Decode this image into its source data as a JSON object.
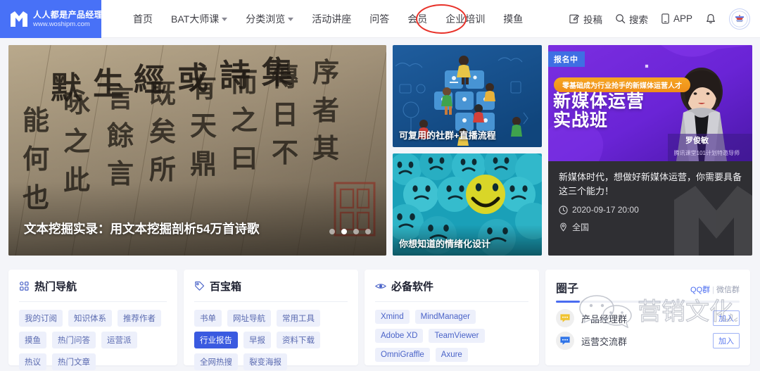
{
  "header": {
    "logo": {
      "icon": "woshipm-logo-icon",
      "cn": "人人都是产品经理",
      "url": "www.woshipm.com"
    },
    "nav": [
      {
        "label": "首页",
        "caret": false
      },
      {
        "label": "BAT大师课",
        "caret": true
      },
      {
        "label": "分类浏览",
        "caret": true
      },
      {
        "label": "活动讲座",
        "caret": false
      },
      {
        "label": "问答",
        "caret": false
      },
      {
        "label": "会员",
        "caret": false
      },
      {
        "label": "企业培训",
        "caret": false
      },
      {
        "label": "摸鱼",
        "caret": false
      }
    ],
    "actions": [
      {
        "icon": "compose-icon",
        "label": "投稿"
      },
      {
        "icon": "search-icon",
        "label": "搜索"
      },
      {
        "icon": "phone-icon",
        "label": "APP"
      },
      {
        "icon": "bell-icon",
        "label": ""
      }
    ],
    "avatar_label": "user-avatar",
    "annotation_color": "#e8322a",
    "annotation_target": "摸鱼"
  },
  "hero": {
    "title": "文本挖掘实录：用文本挖掘剖析54万首诗歌",
    "dots": 4,
    "active_dot": 2
  },
  "midcards": [
    {
      "title": "可复用的社群+直播流程"
    },
    {
      "title": "你想知道的情绪化设计"
    }
  ],
  "promo": {
    "badge": "报名中",
    "pill": "零基础成为行业抢手的新媒体运营人才",
    "heading_line1": "新媒体运营",
    "heading_line2": "实战班",
    "speaker_name": "罗俊敏",
    "speaker_sub": "腾讯课堂101计划特邀导师",
    "description": "新媒体时代，想做好新媒体运营，你需要具备这三个能力！",
    "time_icon": "clock-icon",
    "time": "2020-09-17 20:00",
    "location_icon": "location-pin-icon",
    "location": "全国"
  },
  "cards": [
    {
      "icon": "grid-icon",
      "title": "热门导航",
      "tags": [
        {
          "label": "我的订阅",
          "active": false
        },
        {
          "label": "知识体系",
          "active": false
        },
        {
          "label": "推荐作者",
          "active": false
        },
        {
          "label": "摸鱼",
          "active": false
        },
        {
          "label": "热门问答",
          "active": false
        },
        {
          "label": "运营派",
          "active": false
        },
        {
          "label": "热议",
          "active": false
        },
        {
          "label": "热门文章",
          "active": false
        }
      ]
    },
    {
      "icon": "tag-icon",
      "title": "百宝箱",
      "tags": [
        {
          "label": "书单",
          "active": false
        },
        {
          "label": "网址导航",
          "active": false
        },
        {
          "label": "常用工具",
          "active": false
        },
        {
          "label": "行业报告",
          "active": true
        },
        {
          "label": "早报",
          "active": false
        },
        {
          "label": "资料下载",
          "active": false
        },
        {
          "label": "全网热搜",
          "active": false
        },
        {
          "label": "裂变海报",
          "active": false
        }
      ]
    },
    {
      "icon": "eye-icon",
      "title": "必备软件",
      "tags": [
        {
          "label": "Xmind",
          "active": false
        },
        {
          "label": "MindManager",
          "active": false
        },
        {
          "label": "Adobe XD",
          "active": false
        },
        {
          "label": "TeamViewer",
          "active": false
        },
        {
          "label": "OmniGraffle",
          "active": false
        },
        {
          "label": "Axure",
          "active": false
        }
      ]
    }
  ],
  "circles": {
    "title": "圈子",
    "link_qq": "QQ群",
    "link_sep": "|",
    "link_wechat": "微信群",
    "rows": [
      {
        "icon": "chat-bubble-yellow-icon",
        "name": "产品经理群",
        "join": "加入"
      },
      {
        "icon": "chat-bubble-blue-icon",
        "name": "运营交流群",
        "join": "加入"
      }
    ]
  },
  "watermark": {
    "icon": "wechat-icon",
    "text": "营销文化人"
  },
  "colors": {
    "brand": "#4871f7",
    "accent": "#3a5ae0",
    "annotation": "#e8322a",
    "tag_bg": "#edf0fb"
  }
}
